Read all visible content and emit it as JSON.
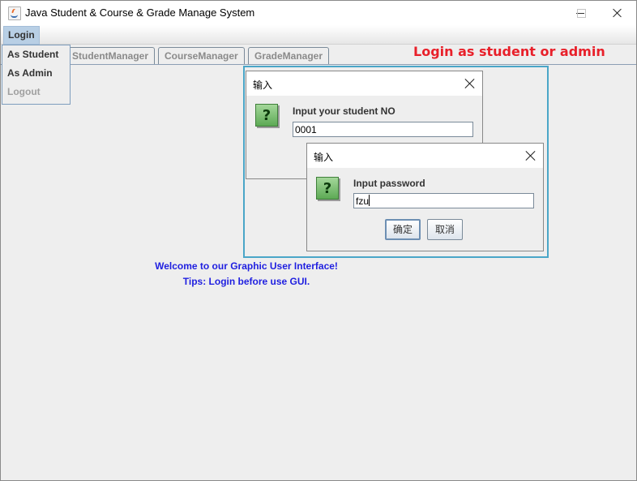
{
  "window": {
    "title": "Java Student & Course & Grade Manage System",
    "controls": {
      "minimize": "minimize-icon",
      "maximize": "maximize-icon",
      "close": "close-icon"
    }
  },
  "menubar": {
    "login_label": "Login"
  },
  "login_menu": {
    "items": [
      {
        "label": "As Student",
        "enabled": true
      },
      {
        "label": "As Admin",
        "enabled": true
      },
      {
        "label": "Logout",
        "enabled": false
      }
    ]
  },
  "tabs": [
    {
      "label": "StudentManager"
    },
    {
      "label": "CourseManager"
    },
    {
      "label": "GradeManager"
    }
  ],
  "annotation": {
    "text": "Login as student or admin",
    "color": "#e8202a"
  },
  "dialog_student": {
    "title": "输入",
    "prompt": "Input your student NO",
    "value": "0001"
  },
  "dialog_password": {
    "title": "输入",
    "prompt": "Input password",
    "value": "fzu",
    "ok_label": "确定",
    "cancel_label": "取消"
  },
  "welcome": {
    "line1": "Welcome to our Graphic User Interface!",
    "line2": "Tips: Login before use GUI.",
    "color": "#1f1fe0"
  }
}
